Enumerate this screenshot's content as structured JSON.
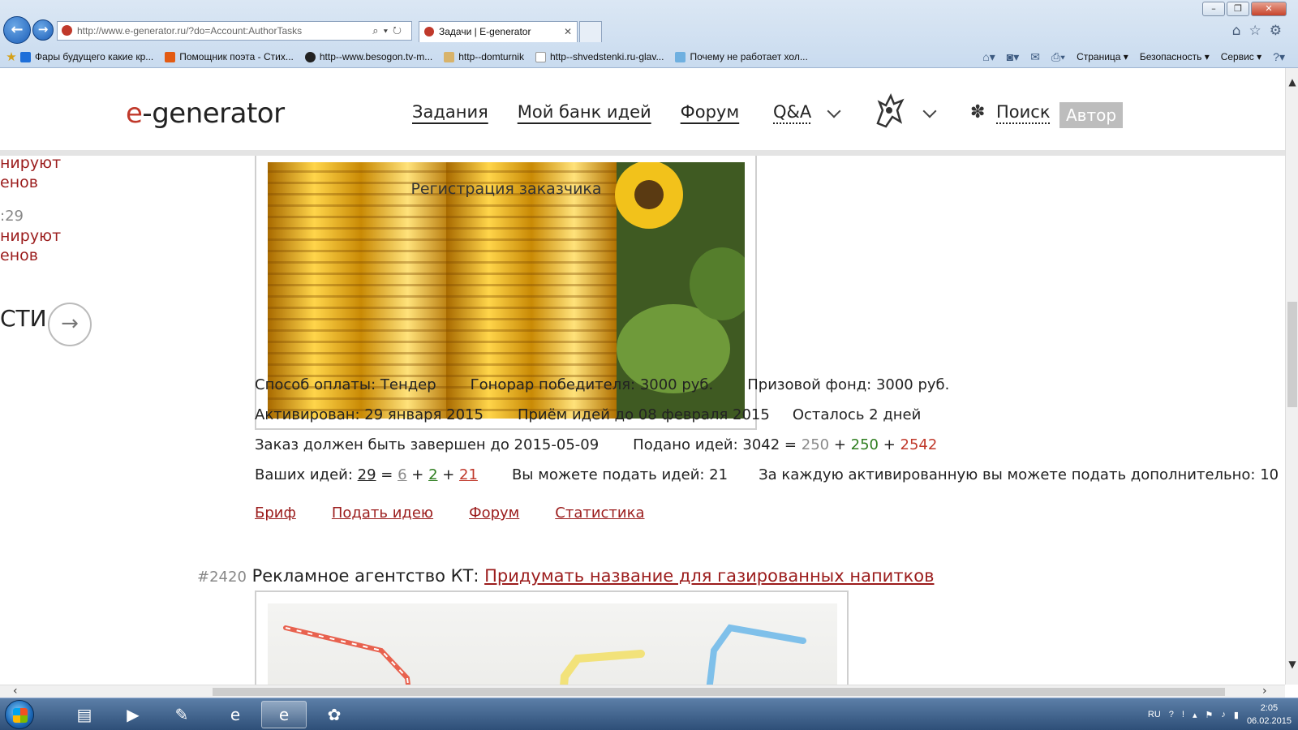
{
  "browser": {
    "url": "http://www.e-generator.ru/?do=Account:AuthorTasks",
    "tab_title": "Задачи | E-generator",
    "favorites": [
      {
        "label": "Фары будущего какие кр...",
        "color": "#1e6fd9"
      },
      {
        "label": "Помощник поэта - Стих...",
        "color": "#e35b13"
      },
      {
        "label": "http--www.besogon.tv-m...",
        "color": "#222222"
      },
      {
        "label": "http--domturnik",
        "color": "#d8b36a"
      },
      {
        "label": "http--shvedstenki.ru-glav...",
        "color": "#ffffff"
      },
      {
        "label": "Почему не работает хол...",
        "color": "#6fb0e0"
      }
    ],
    "commands": [
      "Страница",
      "Безопасность",
      "Сервис"
    ]
  },
  "site": {
    "logo_prefix": "e",
    "logo_rest": "-generator",
    "nav": [
      "Задания",
      "Мой банк идей",
      "Форум"
    ],
    "nav_qa": "Q&A",
    "search": "Поиск",
    "author_button": "Автор"
  },
  "sidebar": {
    "line1": "нируют",
    "line2": "енов",
    "time": ":29",
    "line3": "нируют",
    "line4": "енов",
    "more": "сти"
  },
  "task1": {
    "image_caption": "Регистрация заказчика",
    "payment": "Способ оплаты: Тендер",
    "fee": "Гонорар победителя: 3000 руб.",
    "fund": "Призовой фонд: 3000 руб.",
    "activated": "Активирован: 29 января 2015",
    "deadline": "Приём идей до 08 февраля 2015",
    "remaining": "Осталось 2 дней",
    "complete_by": "Заказ должен быть завершен до 2015-05-09",
    "submitted_label": "Подано идей: 3042 =",
    "submitted_a": "250",
    "submitted_b": "250",
    "submitted_c": "2542",
    "yours_label": "Ваших идей:",
    "yours_total": "29",
    "yours_a": "6",
    "yours_b": "2",
    "yours_c": "21",
    "can_submit": "Вы можете подать идей: 21",
    "extra": "За каждую активированную вы можете подать дополнительно: 10",
    "actions": [
      "Бриф",
      "Подать идею",
      "Форум",
      "Статистика"
    ]
  },
  "task2": {
    "number": "#2420",
    "client": "Рекламное агентство КТ:",
    "title": "Придумать название для газированных напитков"
  },
  "taskbar": {
    "lang": "RU",
    "time": "2:05",
    "date": "06.02.2015"
  }
}
